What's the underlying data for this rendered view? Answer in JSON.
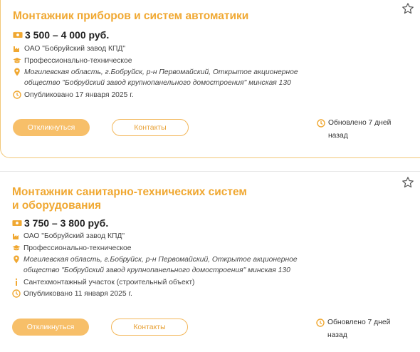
{
  "colors": {
    "accent": "#f0a832",
    "button_fill": "#f7bf69",
    "border": "#f2c879"
  },
  "vacancies": [
    {
      "title": "Монтажник приборов и систем автоматики",
      "salary": "3 500 – 4 000 руб.",
      "company": "ОАО \"Бобруйский завод КПД\"",
      "education": "Профессионально-техническое",
      "address": "Могилевская область, г.Бобруйск, р-н Первомайский, Открытое акционерное общество \"Бобруйский завод крупнопанельного домостроения\" минская 130",
      "published": "Опубликовано 17 января 2025 г.",
      "apply_label": "Откликнуться",
      "contacts_label": "Контакты",
      "updated": "Обновлено 7 дней назад"
    },
    {
      "title": "Монтажник санитарно-технических систем и оборудования",
      "salary": "3 750 – 3 800 руб.",
      "company": "ОАО \"Бобруйский завод КПД\"",
      "education": "Профессионально-техническое",
      "address": "Могилевская область, г.Бобруйск, р-н Первомайский, Открытое акционерное общество \"Бобруйский завод крупнопанельного домостроения\" минская 130",
      "department": "Сантехмонтажный участок (строительный объект)",
      "published": "Опубликовано 11 января 2025 г.",
      "apply_label": "Откликнуться",
      "contacts_label": "Контакты",
      "updated": "Обновлено 7 дней назад"
    }
  ],
  "icons": [
    "money-icon",
    "factory-icon",
    "graduation-cap-icon",
    "location-pin-icon",
    "info-icon",
    "clock-icon",
    "star-icon"
  ]
}
